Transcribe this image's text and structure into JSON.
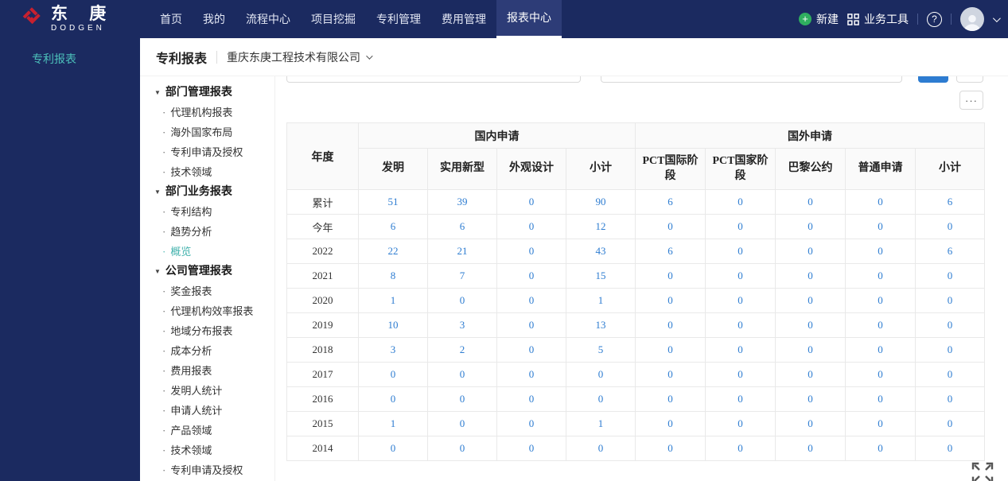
{
  "navbar": {
    "logo_cn": "东 庚",
    "logo_en": "DODGEN",
    "items": [
      {
        "label": "首页",
        "active": false
      },
      {
        "label": "我的",
        "active": false
      },
      {
        "label": "流程中心",
        "active": false
      },
      {
        "label": "项目挖掘",
        "active": false
      },
      {
        "label": "专利管理",
        "active": false
      },
      {
        "label": "费用管理",
        "active": false
      },
      {
        "label": "报表中心",
        "active": true
      }
    ],
    "new_label": "新建",
    "tools_label": "业务工具",
    "help_label": "?"
  },
  "sidebar": {
    "title": "专利报表"
  },
  "tree": {
    "groups": [
      {
        "label": "部门管理报表",
        "items": [
          {
            "label": "代理机构报表",
            "active": false
          },
          {
            "label": "海外国家布局",
            "active": false
          },
          {
            "label": "专利申请及授权",
            "active": false
          },
          {
            "label": "技术领域",
            "active": false
          }
        ]
      },
      {
        "label": "部门业务报表",
        "items": [
          {
            "label": "专利结构",
            "active": false
          },
          {
            "label": "趋势分析",
            "active": false
          },
          {
            "label": "概览",
            "active": true
          }
        ]
      },
      {
        "label": "公司管理报表",
        "items": [
          {
            "label": "奖金报表",
            "active": false
          },
          {
            "label": "代理机构效率报表",
            "active": false
          },
          {
            "label": "地域分布报表",
            "active": false
          },
          {
            "label": "成本分析",
            "active": false
          },
          {
            "label": "费用报表",
            "active": false
          },
          {
            "label": "发明人统计",
            "active": false
          },
          {
            "label": "申请人统计",
            "active": false
          },
          {
            "label": "产品领域",
            "active": false
          },
          {
            "label": "技术领域",
            "active": false
          },
          {
            "label": "专利申请及授权",
            "active": false
          }
        ]
      }
    ]
  },
  "header": {
    "title": "专利报表",
    "company": "重庆东庚工程技术有限公司"
  },
  "toolbar": {
    "more_label": "···"
  },
  "colors": {
    "navbar": "#1b2a60",
    "accent_teal": "#45b3ae",
    "link_blue": "#2d7cd1",
    "logo_red": "#c8202f",
    "new_green": "#2fae5f"
  },
  "chart_data": {
    "type": "table",
    "column_groups": [
      {
        "label": "国内申请",
        "span": 4
      },
      {
        "label": "国外申请",
        "span": 5
      }
    ],
    "columns": [
      "年度",
      "发明",
      "实用新型",
      "外观设计",
      "小计",
      "PCT国际阶段",
      "PCT国家阶段",
      "巴黎公约",
      "普通申请",
      "小计"
    ],
    "rows": [
      [
        "累计",
        51,
        39,
        0,
        90,
        6,
        0,
        0,
        0,
        6
      ],
      [
        "今年",
        6,
        6,
        0,
        12,
        0,
        0,
        0,
        0,
        0
      ],
      [
        "2022",
        22,
        21,
        0,
        43,
        6,
        0,
        0,
        0,
        6
      ],
      [
        "2021",
        8,
        7,
        0,
        15,
        0,
        0,
        0,
        0,
        0
      ],
      [
        "2020",
        1,
        0,
        0,
        1,
        0,
        0,
        0,
        0,
        0
      ],
      [
        "2019",
        10,
        3,
        0,
        13,
        0,
        0,
        0,
        0,
        0
      ],
      [
        "2018",
        3,
        2,
        0,
        5,
        0,
        0,
        0,
        0,
        0
      ],
      [
        "2017",
        0,
        0,
        0,
        0,
        0,
        0,
        0,
        0,
        0
      ],
      [
        "2016",
        0,
        0,
        0,
        0,
        0,
        0,
        0,
        0,
        0
      ],
      [
        "2015",
        1,
        0,
        0,
        1,
        0,
        0,
        0,
        0,
        0
      ],
      [
        "2014",
        0,
        0,
        0,
        0,
        0,
        0,
        0,
        0,
        0
      ]
    ]
  }
}
